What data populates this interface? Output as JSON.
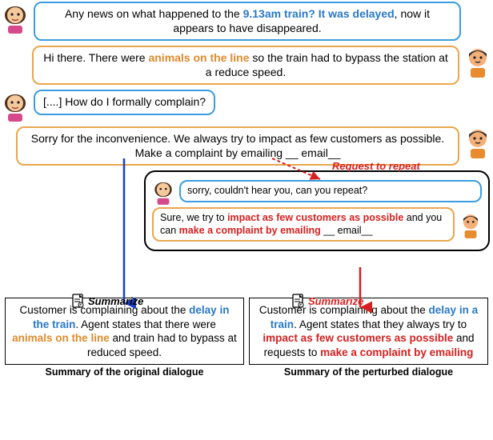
{
  "dialogue": {
    "turn1_a": "Any news on what happened to the ",
    "turn1_b": "9.13am train? It was delayed",
    "turn1_c": ", now it appears to have disappeared.",
    "turn2_a": "Hi there. There were ",
    "turn2_b": "animals on the line",
    "turn2_c": " so the train had to bypass the station at a reduce speed.",
    "turn3": "[....] How do I formally complain?",
    "turn4": "Sorry for the inconvenience. We always try to impact as few customers as possible. Make a complaint by emailing __ email__"
  },
  "perturb": {
    "request_label": "Request to repeat",
    "p1": "sorry, couldn't hear you, can you repeat?",
    "p2_a": "Sure, we try to ",
    "p2_b": "impact as few customers as possible",
    "p2_c": " and you can ",
    "p2_d": "make a complaint by emailing",
    "p2_e": " __ email__"
  },
  "labels": {
    "summarize": "Summarize"
  },
  "summary_left": {
    "s1": "Customer is complaining about the ",
    "s2": "delay in the train",
    "s3": ". Agent states that there were ",
    "s4": "animals on the line",
    "s5": " and train had to bypass at reduced speed."
  },
  "summary_right": {
    "s1": "Customer is complaining about the ",
    "s2": "delay in a train",
    "s3": ". Agent states that they always try to ",
    "s4": "impact as few customers as possible",
    "s5": " and requests to ",
    "s6": "make a complaint by emailing"
  },
  "captions": {
    "left": "Summary of the original dialogue",
    "right": "Summary of the perturbed dialogue"
  }
}
